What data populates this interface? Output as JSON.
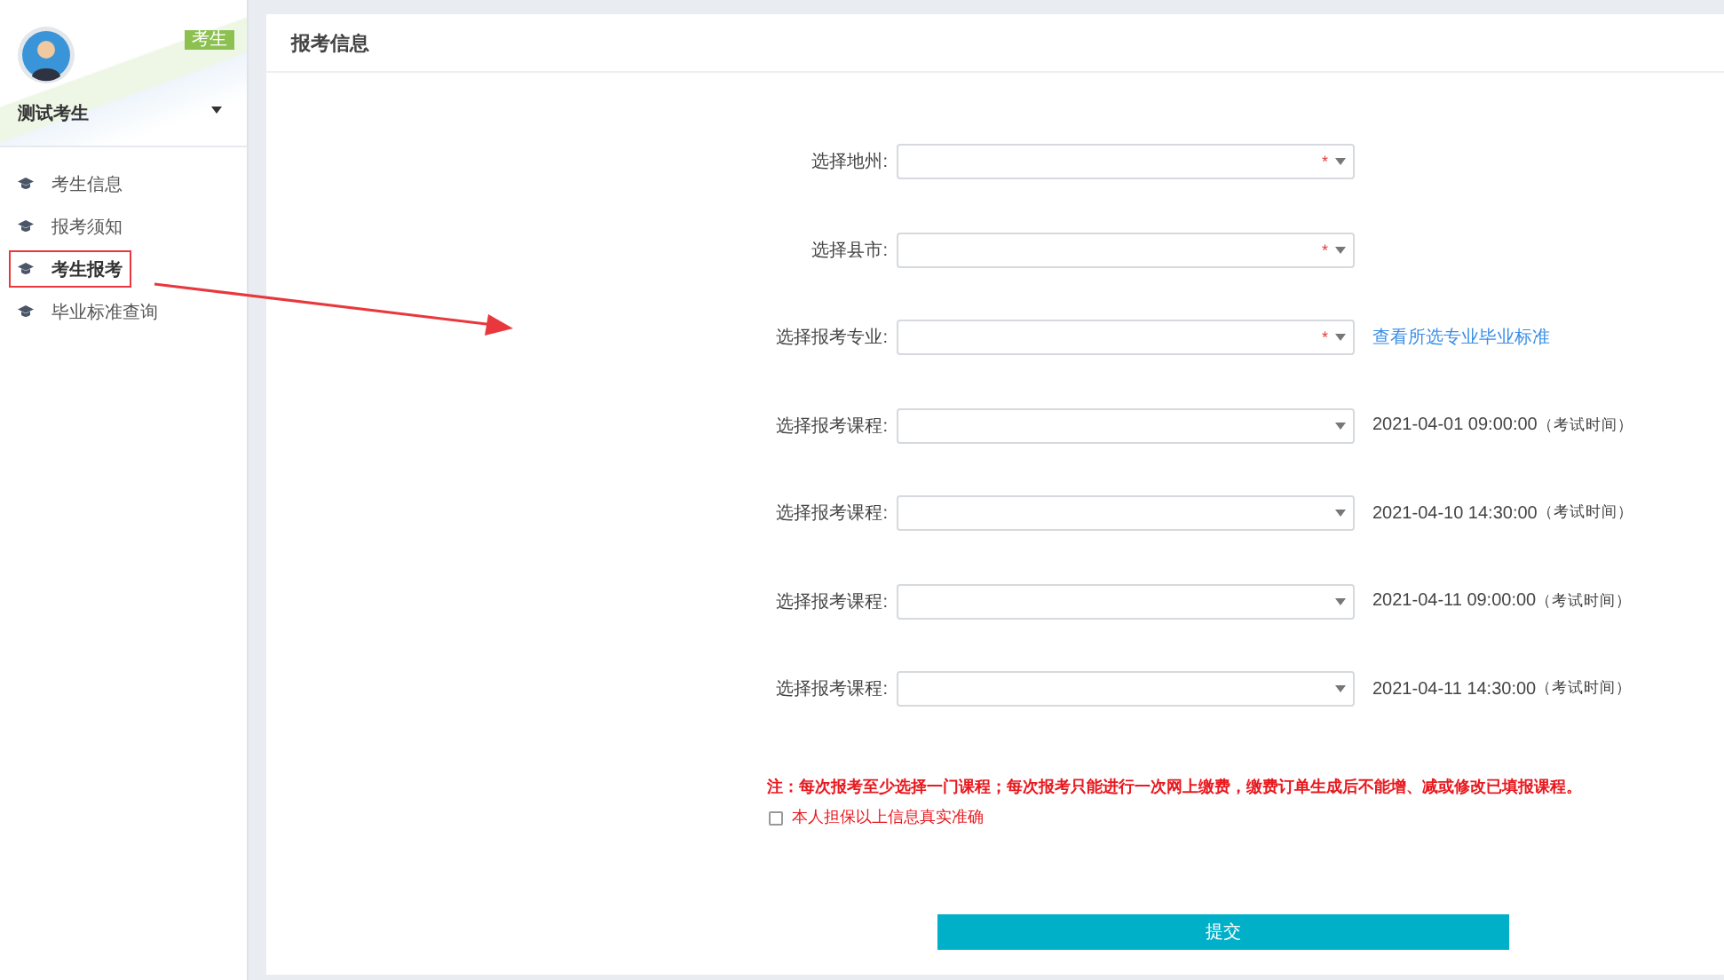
{
  "sidebar": {
    "badge": "考生",
    "user_name": "测试考生",
    "menu": [
      {
        "label": "考生信息",
        "selected": false
      },
      {
        "label": "报考须知",
        "selected": false
      },
      {
        "label": "考生报考",
        "selected": true
      },
      {
        "label": "毕业标准查询",
        "selected": false
      }
    ]
  },
  "panel": {
    "title": "报考信息"
  },
  "fields": [
    {
      "kind": "required",
      "label": "选择地州:",
      "mark": "*"
    },
    {
      "kind": "required",
      "label": "选择县市:",
      "mark": "*"
    },
    {
      "kind": "required",
      "label": "选择报考专业:",
      "mark": "*",
      "link": "查看所选专业毕业标准"
    },
    {
      "kind": "course",
      "label": "选择报考课程:",
      "time": "2021-04-01 09:00:00",
      "time_note": "（考试时间）"
    },
    {
      "kind": "course",
      "label": "选择报考课程:",
      "time": "2021-04-10 14:30:00",
      "time_note": "（考试时间）"
    },
    {
      "kind": "course",
      "label": "选择报考课程:",
      "time": "2021-04-11 09:00:00",
      "time_note": "（考试时间）"
    },
    {
      "kind": "course",
      "label": "选择报考课程:",
      "time": "2021-04-11 14:30:00",
      "time_note": "（考试时间）"
    }
  ],
  "notice": "注：每次报考至少选择一门课程；每次报考只能进行一次网上缴费，缴费订单生成后不能增、减或修改已填报课程。",
  "pledge": {
    "label": "本人担保以上信息真实准确",
    "checked": false
  },
  "submit": "提交"
}
